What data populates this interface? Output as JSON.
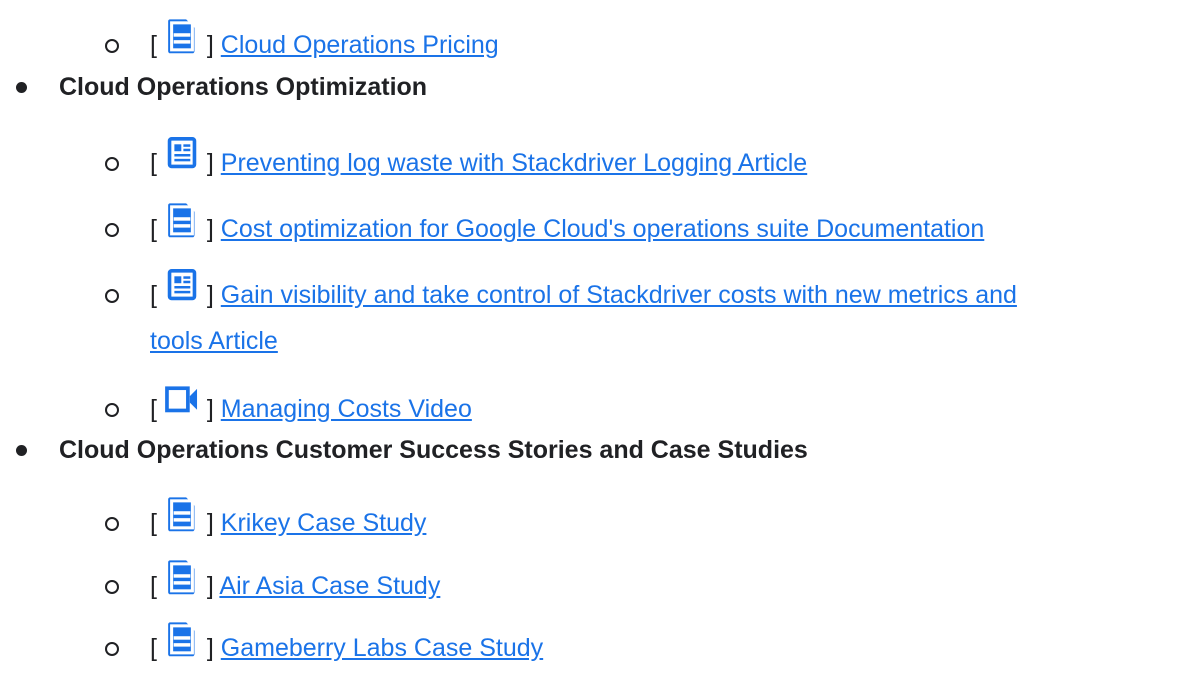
{
  "sections": [
    {
      "items": [
        {
          "icon": "document-icon",
          "link": "Cloud Operations Pricing"
        }
      ]
    },
    {
      "title": "Cloud Operations Optimization",
      "items": [
        {
          "icon": "article-icon",
          "link": "Preventing log waste with Stackdriver Logging Article"
        },
        {
          "icon": "document-icon",
          "link": "Cost optimization for Google Cloud's operations suite Documentation"
        },
        {
          "icon": "article-icon",
          "link_line1": "Gain visibility and take control of Stackdriver costs with new metrics and",
          "link_line2": "tools Article"
        },
        {
          "icon": "video-icon",
          "link": "Managing Costs Video"
        }
      ]
    },
    {
      "title": "Cloud Operations Customer Success Stories and Case Studies",
      "items": [
        {
          "icon": "document-icon",
          "link": "Krikey Case Study"
        },
        {
          "icon": "document-icon",
          "link": "Air Asia Case Study"
        },
        {
          "icon": "document-icon",
          "link": "Gameberry Labs Case Study"
        }
      ]
    }
  ],
  "bracket_open": "[",
  "bracket_close": "]",
  "colors": {
    "link": "#1a73e8",
    "text": "#202124"
  }
}
